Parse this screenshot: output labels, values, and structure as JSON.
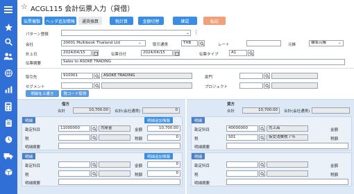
{
  "window": {
    "title": "ACGL115 会計伝票入力（貸借）"
  },
  "toolbar": {
    "buttons": [
      "伝票複製",
      "ヘッダ追加情報",
      "通貨換算",
      "税計算",
      "金額切替",
      "確認",
      "転記"
    ]
  },
  "header": {
    "pattern_label": "パターン登録",
    "pattern_value": "",
    "company_label": "会社",
    "company_value": "20001 Multibook Thailand Ltd",
    "currency_label": "取引通貨",
    "currency_value": "THB",
    "rate_label": "レート",
    "rate_value": "",
    "ledger_label": "元帳",
    "ledger_value": "標準元帳",
    "post_date_label": "計上日",
    "post_date_value": "2024/04/15",
    "doc_date_label": "伝票日付",
    "doc_date_value": "2024/04/15",
    "doc_type_label": "伝票タイプ",
    "doc_type_value": "A1",
    "summary_label": "伝票摘要",
    "summary_value": "Sales to ASOKE TRADING"
  },
  "partner": {
    "partner_label": "取引先",
    "partner_code": "910001",
    "partner_name": "ASOKE TRADING",
    "dept_label": "部門",
    "segment_label": "セグメント",
    "project_label": "プロジェクト",
    "copy_button": "明細を上書き",
    "tax_code_button": "税コード取得"
  },
  "debit": {
    "title": "借方",
    "total_label": "合計",
    "total_value": "10,700.00",
    "total_company_label": "合計(会社通貨)",
    "total_company_value": "0",
    "line_tag": "明細",
    "add_info_button": "明細追加情報",
    "account_label": "勘定科目",
    "account_code": "11000000",
    "account_name": "売掛金",
    "amount_label": "金額",
    "amount_value": "10,700.00",
    "tax_label": "税",
    "tax_amount_label": "税額",
    "tax_amount_value": "0",
    "memo_label": "明細摘要",
    "line2_tag": "明細",
    "line2_add_info_button": "明細追加情報",
    "line2_account_label": "勘定科目",
    "line2_amount_label": "金額",
    "line2_amount_value": "0",
    "line2_tax_label": "税",
    "line2_tax_amount_label": "税額",
    "line2_tax_amount_value": "0",
    "line2_memo_label": "明細摘要"
  },
  "credit": {
    "title": "貸方",
    "total_label": "合計",
    "total_value": "10,700.00",
    "total_company_label": "合計(会社通貨)",
    "line_tag": "明細",
    "account_label": "勘定科目",
    "account_code": "40000000",
    "account_name": "売上高",
    "amount_label": "金額",
    "tax_label": "税",
    "tax_code": "S01",
    "tax_name": "仮受消費税７％",
    "tax_amount_label": "税額",
    "memo_label": "明細摘要",
    "line2_tag": "明細",
    "line2_account_label": "勘定科目",
    "line2_amount_label": "金額",
    "line2_tax_label": "税",
    "line2_tax_amount_label": "税額",
    "line2_memo_label": "明細摘要"
  },
  "colors": {
    "sidebar": "#2f6fd6",
    "primary_button": "#3a8de0",
    "post_button": "#f0a07a",
    "panel": "#dce8f6"
  },
  "sidebar_icons": [
    "menu-icon",
    "star-icon",
    "search-icon",
    "users-icon",
    "globe-icon",
    "chart-icon",
    "calculator-icon",
    "clipboard-icon",
    "clock-icon",
    "truck-icon",
    "box-icon"
  ]
}
